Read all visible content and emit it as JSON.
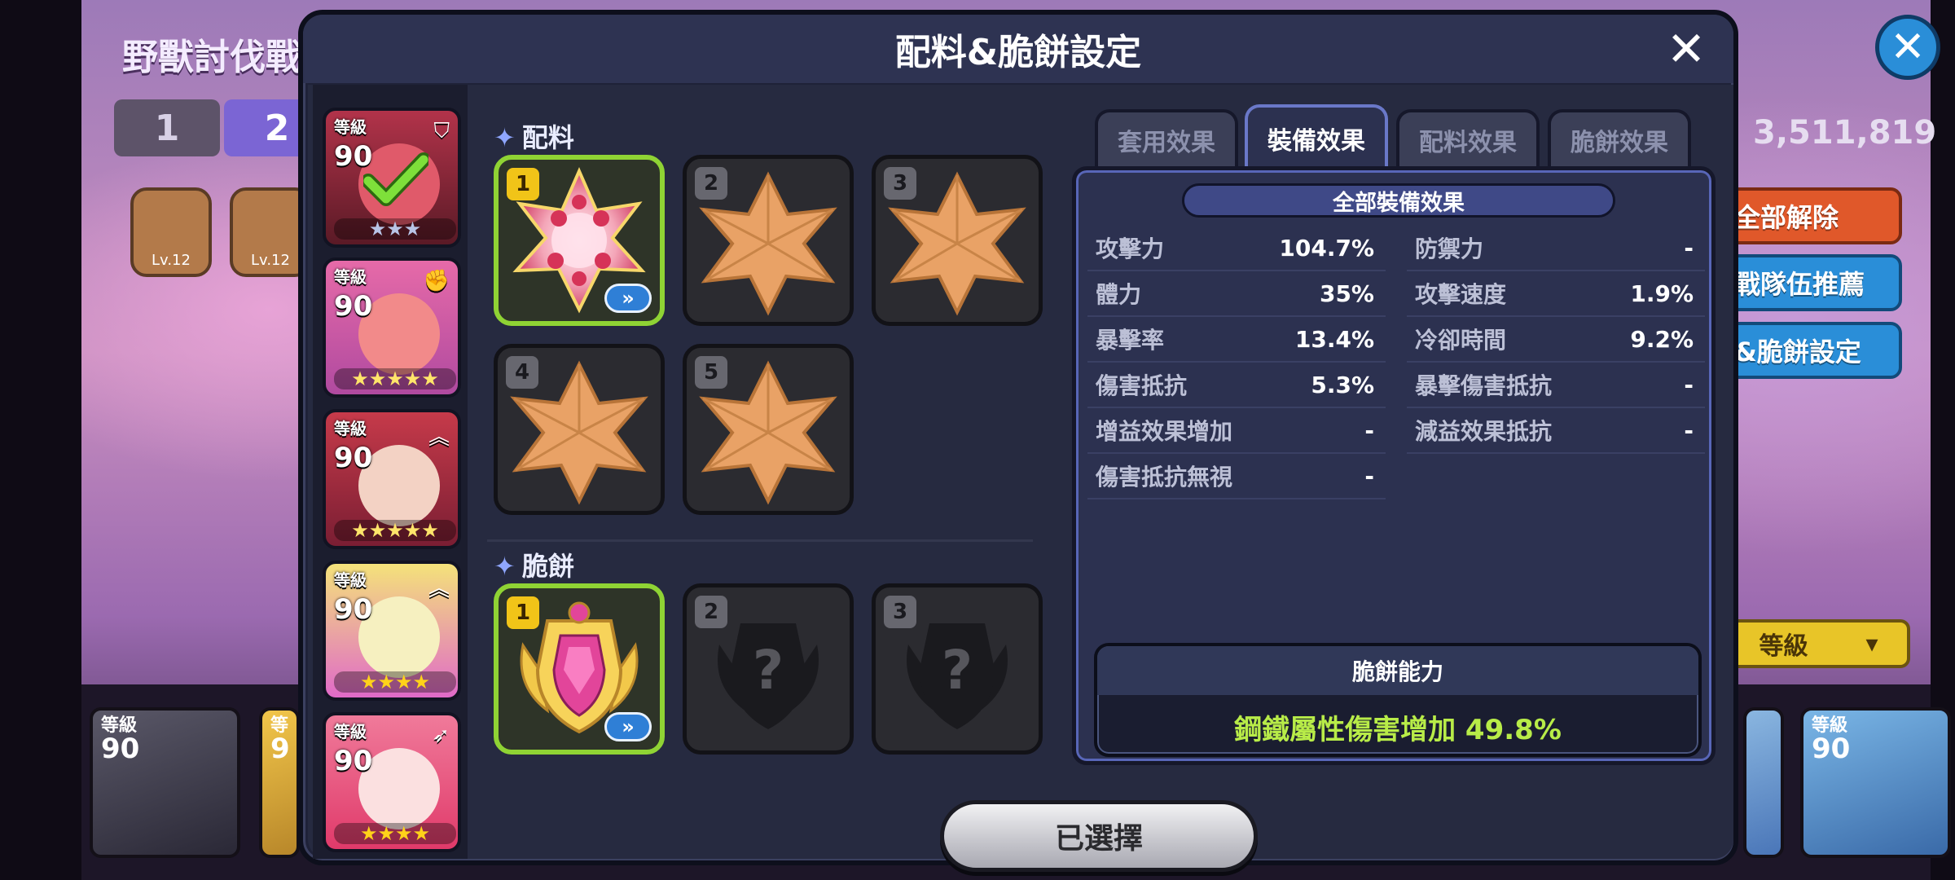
{
  "background": {
    "title": "野獸討伐戰",
    "tabs": [
      "1",
      "2"
    ],
    "hex_items": [
      {
        "label": "Lv.12",
        "icon": "trident-icon",
        "color": "#8aa6c8"
      },
      {
        "label": "Lv.12",
        "icon": "pet-icon",
        "color": "#c89a5a"
      }
    ],
    "score": "3,511,819",
    "buttons": {
      "release_all": "全部解除",
      "team_recommend": "戰隊伍推薦",
      "topping_setup": "&脆餅設定"
    },
    "sort_label": "等級",
    "bottom_cards": [
      {
        "level_label": "等級",
        "level": "90"
      },
      {
        "level_label": "等",
        "level": "9"
      },
      {
        "level_label": "等級",
        "level": "90"
      }
    ]
  },
  "modal": {
    "title": "配料&脆餅設定",
    "close_icon": "close-icon",
    "select_button": "已選擇"
  },
  "cookies": [
    {
      "level_label": "等級",
      "level": "90",
      "stars": "★★★",
      "selected": true,
      "color_top": "#b2334a",
      "color_bottom": "#5a1a26",
      "face": "#e05a6a",
      "class_icon": "shield-icon"
    },
    {
      "level_label": "等級",
      "level": "90",
      "stars": "★★★★★",
      "selected": false,
      "color_top": "#e66aa8",
      "color_bottom": "#b04aa0",
      "face": "#f28a8a",
      "class_icon": "fist-icon"
    },
    {
      "level_label": "等級",
      "level": "90",
      "stars": "★★★★★",
      "selected": false,
      "color_top": "#c63a4a",
      "color_bottom": "#7a1e33",
      "face": "#f3d2c4",
      "class_icon": "chevron-up-icon"
    },
    {
      "level_label": "等級",
      "level": "90",
      "stars": "★★★★",
      "selected": false,
      "color_top": "#f4e27a",
      "color_bottom": "#e06ac8",
      "face": "#f6f0c0",
      "class_icon": "chevron-up-icon"
    },
    {
      "level_label": "等級",
      "level": "90",
      "stars": "★★★★",
      "selected": false,
      "color_top": "#f07a9a",
      "color_bottom": "#e03a6a",
      "face": "#fbe0e0",
      "class_icon": "arrow-icon"
    }
  ],
  "toppings": {
    "section_title": "配料",
    "slots": [
      {
        "num": "1",
        "filled": true,
        "icon": "raspberry-topping-icon",
        "upgrade": "»"
      },
      {
        "num": "2",
        "filled": false,
        "icon": "empty-topping-icon"
      },
      {
        "num": "3",
        "filled": false,
        "icon": "empty-topping-icon"
      },
      {
        "num": "4",
        "filled": false,
        "icon": "empty-topping-icon"
      },
      {
        "num": "5",
        "filled": false,
        "icon": "empty-topping-icon"
      }
    ]
  },
  "biscuits": {
    "section_title": "脆餅",
    "slots": [
      {
        "num": "1",
        "filled": true,
        "icon": "biscuit-icon",
        "upgrade": "»"
      },
      {
        "num": "2",
        "filled": false,
        "icon": "locked-biscuit-icon",
        "mark": "?"
      },
      {
        "num": "3",
        "filled": false,
        "icon": "locked-biscuit-icon",
        "mark": "?"
      }
    ]
  },
  "effect_tabs": [
    {
      "label": "套用效果",
      "active": false
    },
    {
      "label": "裝備效果",
      "active": true
    },
    {
      "label": "配料效果",
      "active": false
    },
    {
      "label": "脆餅效果",
      "active": false
    }
  ],
  "effects": {
    "header": "全部裝備效果",
    "left": [
      {
        "name": "攻擊力",
        "value": "104.7%"
      },
      {
        "name": "體力",
        "value": "35%"
      },
      {
        "name": "暴擊率",
        "value": "13.4%"
      },
      {
        "name": "傷害抵抗",
        "value": "5.3%"
      },
      {
        "name": "增益效果增加",
        "value": "-"
      },
      {
        "name": "傷害抵抗無視",
        "value": "-"
      }
    ],
    "right": [
      {
        "name": "防禦力",
        "value": "-"
      },
      {
        "name": "攻擊速度",
        "value": "1.9%"
      },
      {
        "name": "冷卻時間",
        "value": "9.2%"
      },
      {
        "name": "暴擊傷害抵抗",
        "value": "-"
      },
      {
        "name": "減益效果抵抗",
        "value": "-"
      }
    ],
    "ability_title": "脆餅能力",
    "ability_value": "鋼鐵屬性傷害增加 49.8%"
  },
  "colors": {
    "accent_green": "#8fd334",
    "ability_text": "#b8ec48",
    "slot_badge_gold": "#f1c418"
  }
}
